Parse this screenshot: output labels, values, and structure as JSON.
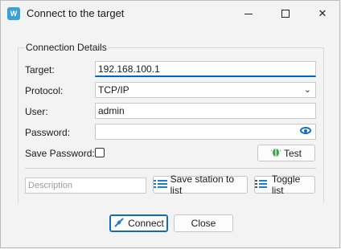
{
  "window": {
    "title": "Connect to the target",
    "app_icon_text": "W"
  },
  "group": {
    "title": "Connection Details"
  },
  "fields": {
    "target_label": "Target:",
    "target_value": "192.168.100.1",
    "protocol_label": "Protocol:",
    "protocol_value": "TCP/IP",
    "user_label": "User:",
    "user_value": "admin",
    "password_label": "Password:",
    "password_value": "",
    "save_password_label": "Save Password:"
  },
  "buttons": {
    "test": "Test",
    "save_station": "Save station to list",
    "toggle_list": "Toggle list",
    "connect": "Connect",
    "close": "Close"
  },
  "description": {
    "placeholder": "Description"
  },
  "colors": {
    "accent": "#0f6cbd",
    "icon_blue": "#1f7fc6",
    "test_icon": "#3aa64a"
  }
}
